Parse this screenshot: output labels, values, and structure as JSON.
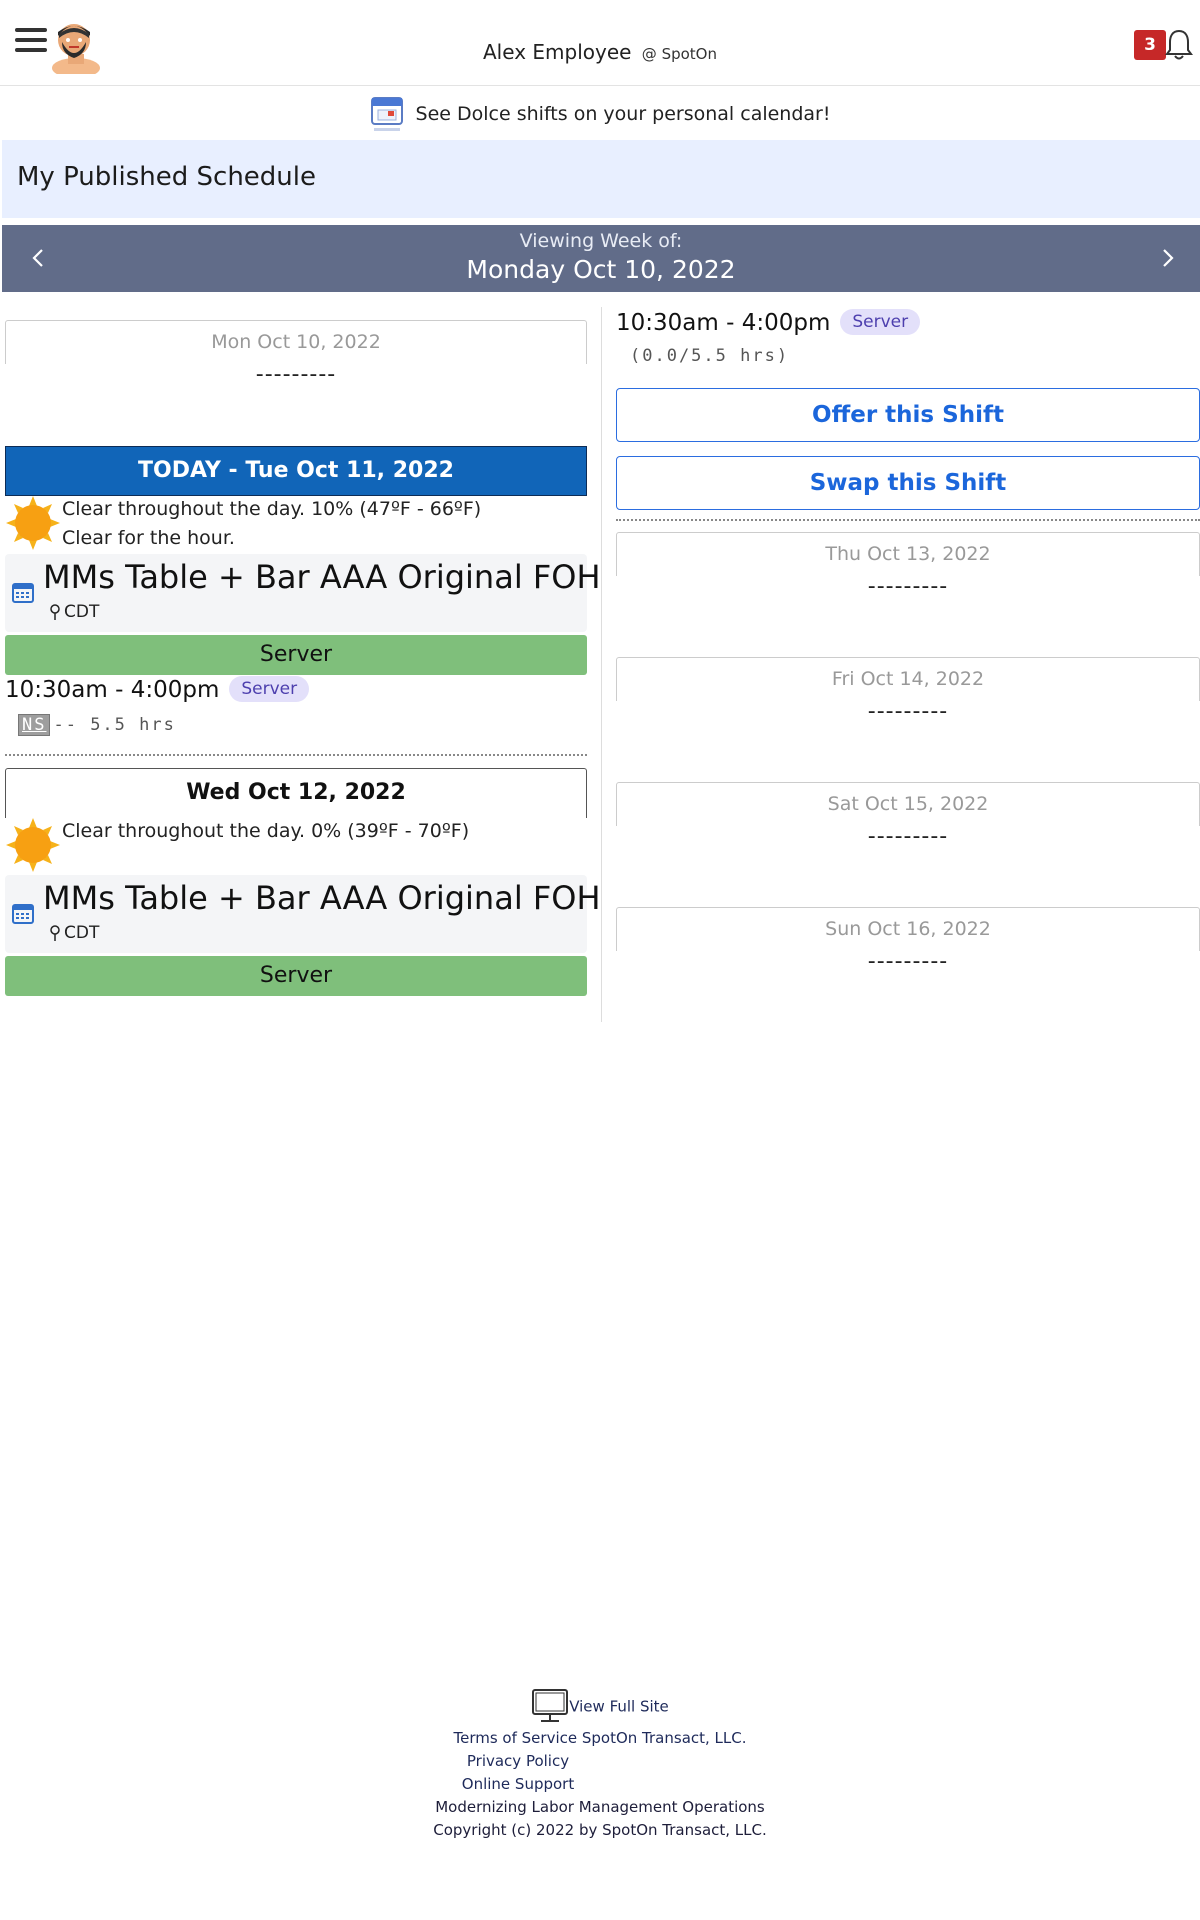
{
  "header": {
    "user_name": "Alex Employee",
    "org": "@ SpotOn",
    "notification_count": "3"
  },
  "calendar_banner": {
    "text": "See Dolce shifts on your personal calendar!"
  },
  "page_title": "My Published Schedule",
  "week": {
    "label": "Viewing Week of:",
    "date": "Monday Oct 10, 2022"
  },
  "days": {
    "mon": {
      "label": "Mon Oct 10, 2022",
      "empty": "---------"
    },
    "tue": {
      "label": "TODAY - Tue Oct 11, 2022",
      "weather_line1": "Clear throughout the day. 10% (47ºF - 66ºF)",
      "weather_line2": "Clear for the hour.",
      "location": "MMs Table + Bar AAA Original FOH",
      "timezone": "CDT",
      "role": "Server",
      "shift_time": "10:30am - 4:00pm",
      "shift_role": "Server",
      "ns": "NS",
      "hours": "-- 5.5 hrs"
    },
    "wed": {
      "label": "Wed Oct 12, 2022",
      "weather_line1": "Clear throughout the day. 0% (39ºF - 70ºF)",
      "location": "MMs Table + Bar AAA Original FOH",
      "timezone": "CDT",
      "role": "Server",
      "shift_time": "10:30am - 4:00pm",
      "shift_role": "Server",
      "hours": "(0.0/5.5 hrs)",
      "offer_label": "Offer this Shift",
      "swap_label": "Swap this Shift"
    },
    "thu": {
      "label": "Thu Oct 13, 2022",
      "empty": "---------"
    },
    "fri": {
      "label": "Fri Oct 14, 2022",
      "empty": "---------"
    },
    "sat": {
      "label": "Sat Oct 15, 2022",
      "empty": "---------"
    },
    "sun": {
      "label": "Sun Oct 16, 2022",
      "empty": "---------"
    }
  },
  "footer": {
    "view_full_site": "View Full Site",
    "terms": "Terms of Service",
    "company_link": "SpotOn Transact, LLC.",
    "privacy": "Privacy Policy",
    "support": "Online Support",
    "tagline": "Modernizing Labor Management Operations",
    "copyright": "Copyright (c) 2022 by SpotOn Transact, LLC."
  },
  "colors": {
    "today_bar": "#1165b8",
    "week_bar": "#616c89",
    "title_bar": "#e8efff",
    "role_bar": "#7fbf7b",
    "action_blue": "#1b66db",
    "badge_red": "#c62828"
  }
}
